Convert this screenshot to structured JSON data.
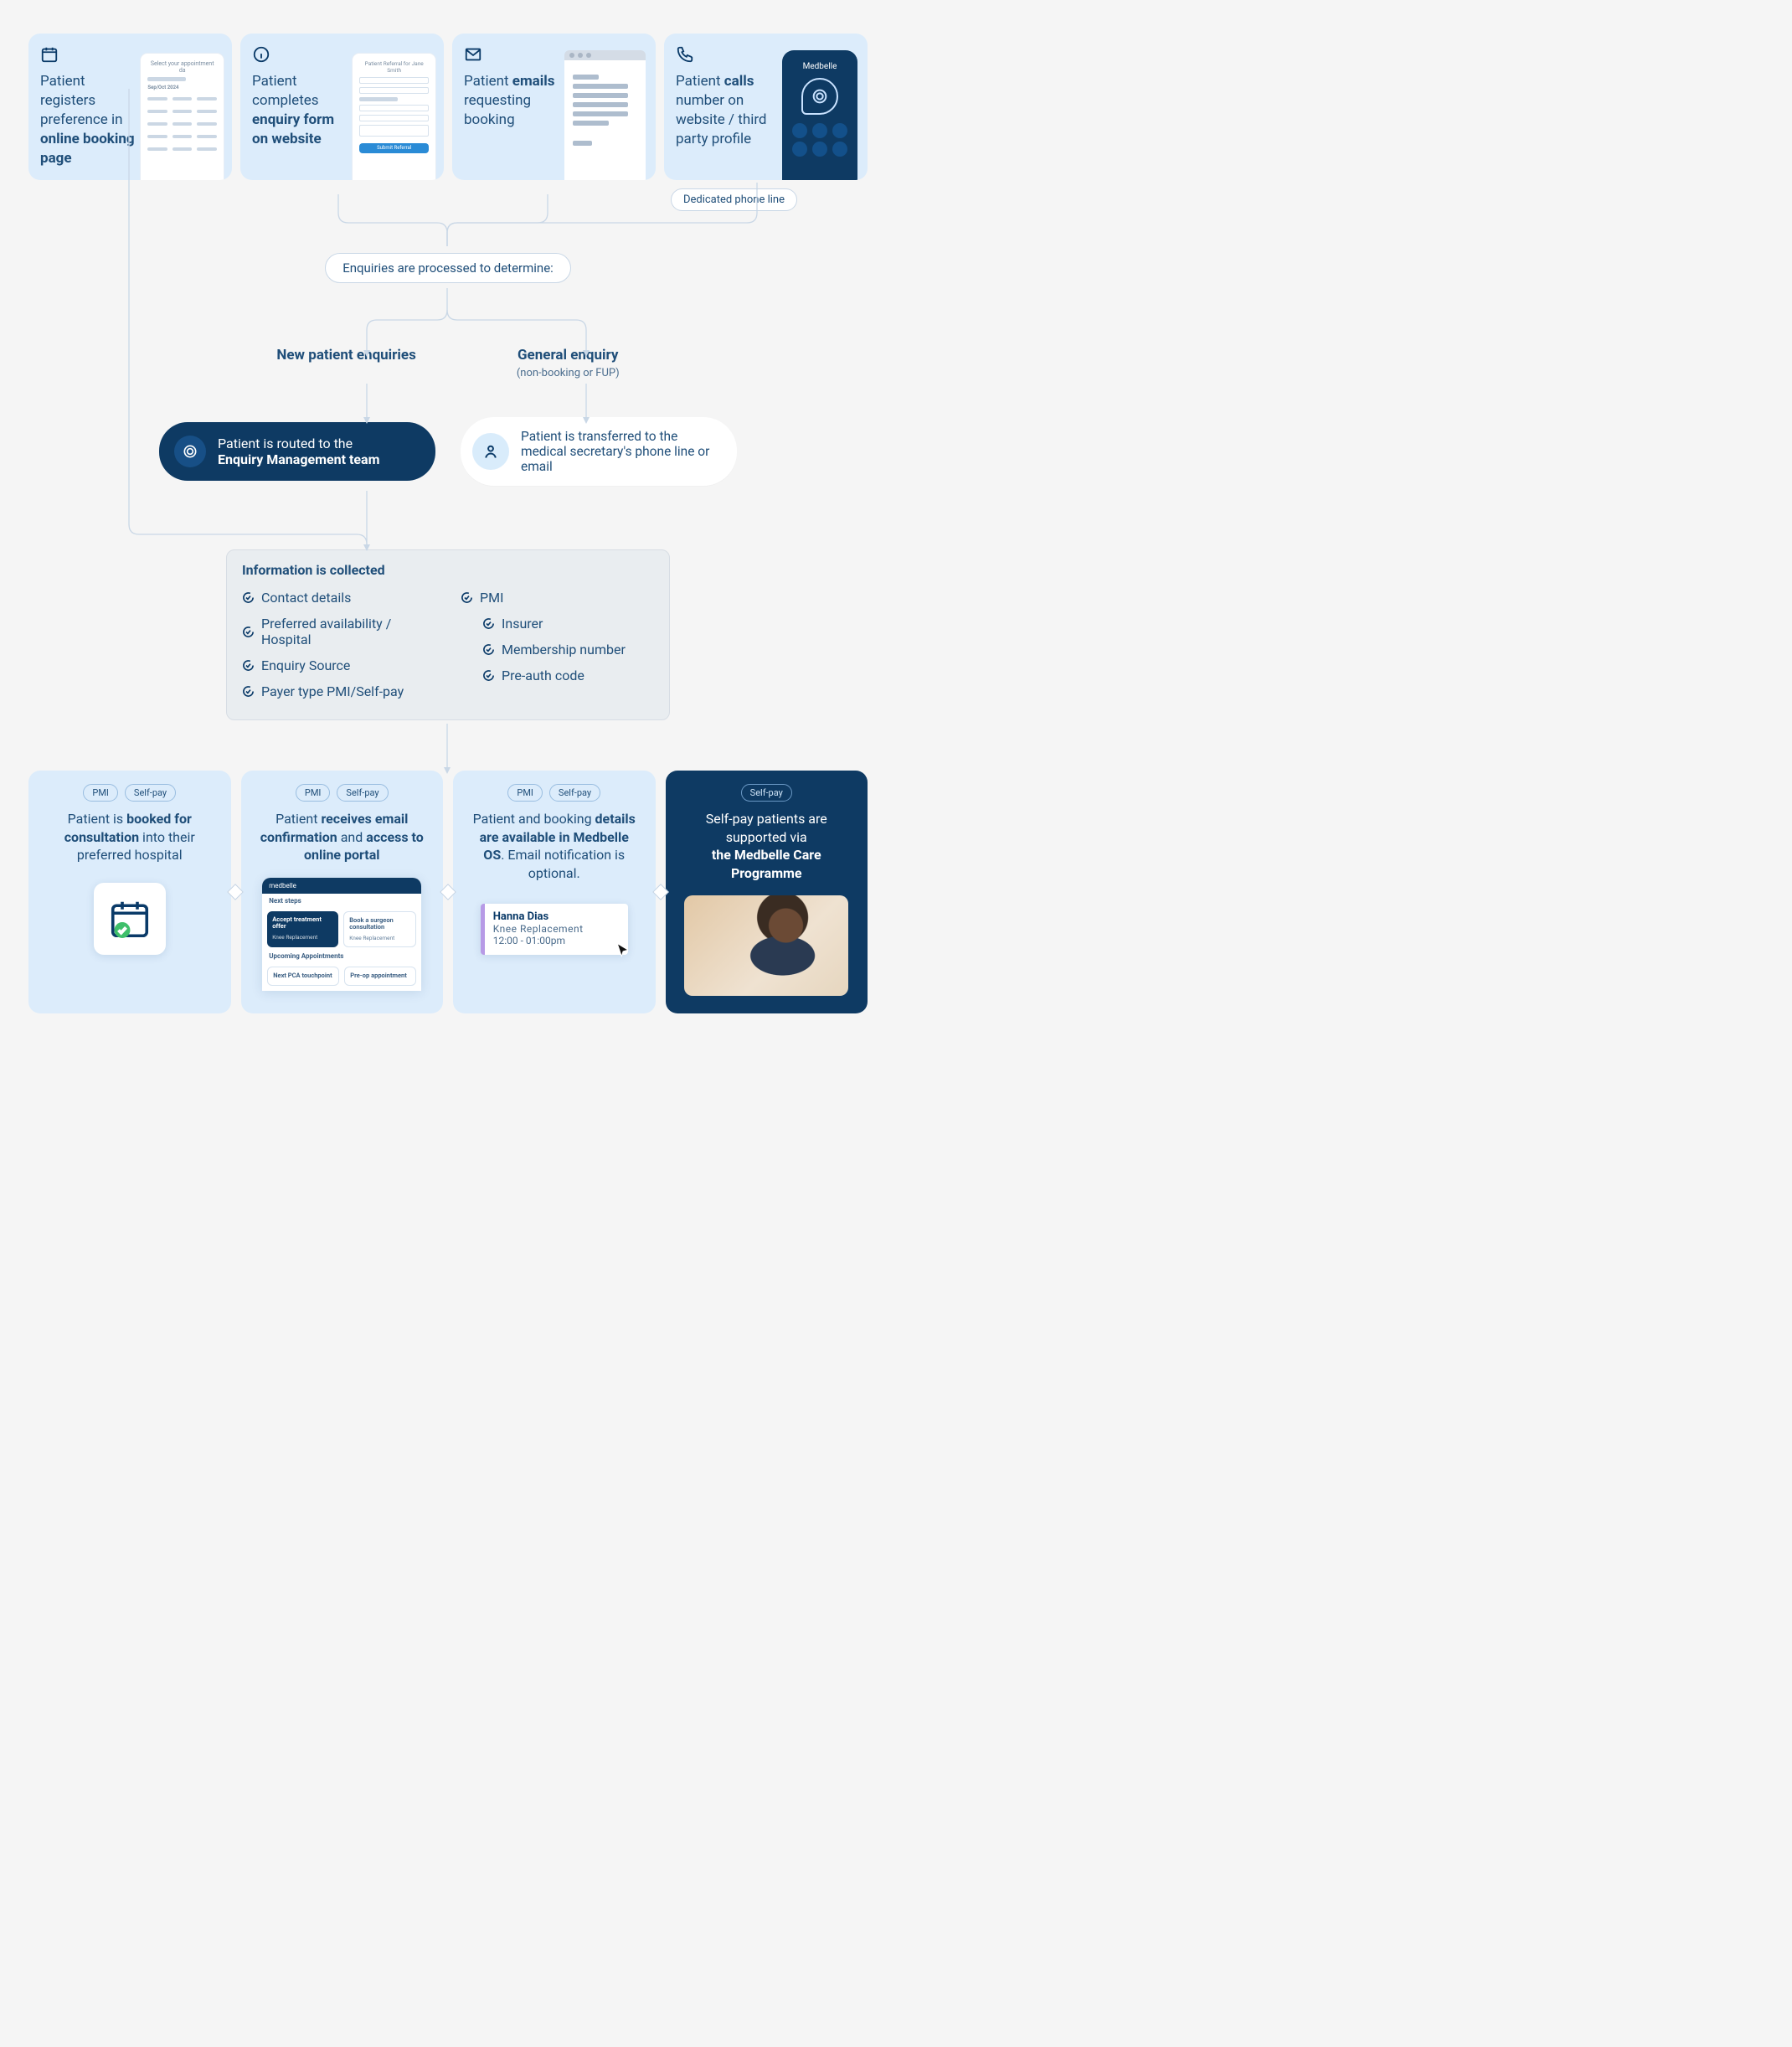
{
  "entry_cards": {
    "booking": {
      "text_pre": "Patient registers preference in ",
      "text_bold": "online booking page",
      "mini_title": "Select your appointment da",
      "mini_sub": "Sep/Oct 2024"
    },
    "form": {
      "text_pre": "Patient completes ",
      "text_bold": "enquiry form on website",
      "mini_title": "Patient Referral for Jane Smith",
      "btn": "Submit Referral"
    },
    "email": {
      "text_pre": "Patient ",
      "text_bold": "emails",
      "text_post": " requesting booking"
    },
    "call": {
      "text_pre": "Patient ",
      "text_bold": "calls",
      "text_post": " number on website / third party profile",
      "brand": "Medbelle"
    }
  },
  "phone_line_chip": "Dedicated phone line",
  "process_chip": "Enquiries are processed to determine:",
  "branch_new": "New patient enquiries",
  "branch_general": "General enquiry",
  "branch_general_sub": "(non-booking or FUP)",
  "route_dark_pre": "Patient is routed to the",
  "route_dark_bold": "Enquiry Management team",
  "route_light": "Patient is transferred to the medical secretary's phone line or email",
  "info_title": "Information is collected",
  "info_left": [
    "Contact details",
    "Preferred availability / Hospital",
    "Enquiry Source",
    "Payer type PMI/Self-pay"
  ],
  "info_right_head": "PMI",
  "info_right": [
    "Insurer",
    "Membership number",
    "Pre-auth code"
  ],
  "pills": {
    "pmi": "PMI",
    "self": "Self-pay"
  },
  "out1": {
    "pre": "Patient is ",
    "bold": "booked for consultation",
    "post": " into their preferred hospital"
  },
  "out2": {
    "pre": "Patient ",
    "bold": "receives email confirmation",
    "mid": " and ",
    "bold2": "access to online portal"
  },
  "out3": {
    "pre": "Patient and booking ",
    "bold": "details are available in Medbelle OS",
    "post": ". Email notification is optional."
  },
  "out4": {
    "pre": "Self-pay patients are supported via",
    "bold": "the Medbelle Care Programme"
  },
  "portal": {
    "brand": "medbelle",
    "next": "Next steps",
    "t1": "Accept treatment offer",
    "s1": "Knee Replacement",
    "t2": "Book a surgeon consultation",
    "s2": "Knee Replacement",
    "up": "Upcoming Appointments",
    "t3": "Next PCA touchpoint",
    "t4": "Pre-op appointment"
  },
  "record": {
    "name": "Hanna Dias",
    "proc": "Knee Replacement",
    "time": "12:00 - 01:00pm"
  }
}
